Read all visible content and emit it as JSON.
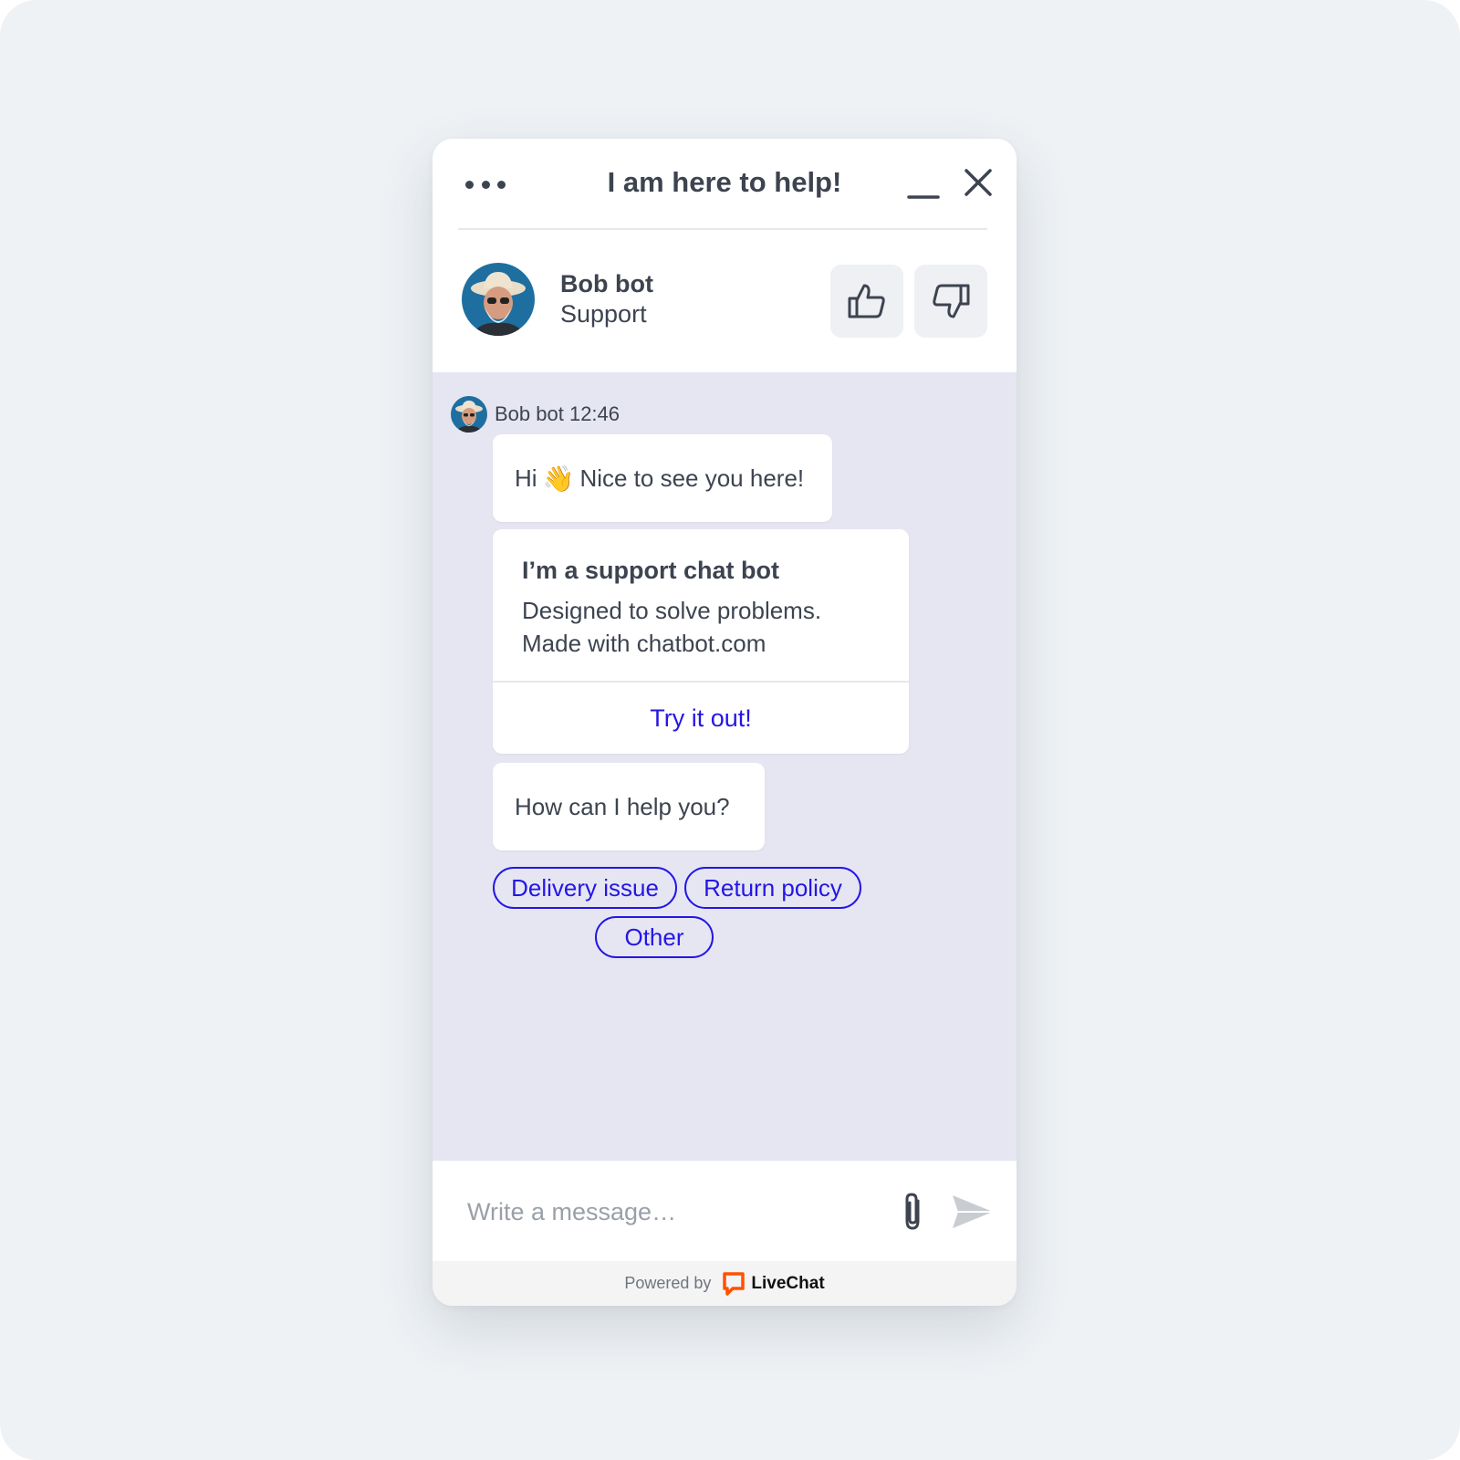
{
  "header": {
    "title": "I am here to help!",
    "menu_icon": "more-horizontal-icon",
    "minimize_icon": "minimize-icon",
    "close_icon": "close-icon"
  },
  "agent": {
    "name": "Bob bot",
    "role": "Support",
    "rate_good_icon": "thumbs-up-icon",
    "rate_bad_icon": "thumbs-down-icon"
  },
  "chat": {
    "sender_meta": "Bob bot 12:46",
    "messages": {
      "greeting_before": "Hi",
      "greeting_emoji": "👋",
      "greeting_after": "Nice to see you here!",
      "card_title": "I’m a support chat bot",
      "card_line1": "Designed to solve problems.",
      "card_line2": "Made with chatbot.com",
      "card_button": "Try it out!",
      "question": "How can I help you?"
    },
    "quick_replies": [
      "Delivery issue",
      "Return policy",
      "Other"
    ]
  },
  "composer": {
    "placeholder": "Write a message…",
    "attach_icon": "paperclip-icon",
    "send_icon": "send-icon"
  },
  "footer": {
    "powered_by": "Powered by",
    "brand": "LiveChat",
    "brand_color": "#ff5100"
  },
  "colors": {
    "accent": "#2416e6",
    "text": "#3d4450",
    "chat_background": "#e6e6f2"
  }
}
